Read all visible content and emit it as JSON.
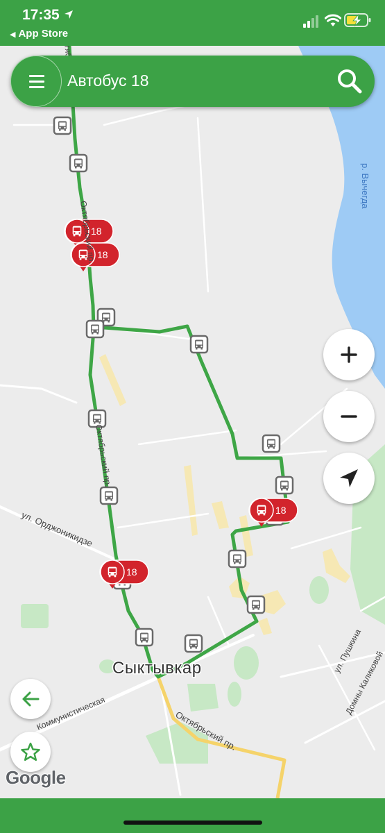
{
  "status_bar": {
    "time": "17:35",
    "back_app": "App Store"
  },
  "search": {
    "title": "Автобус 18"
  },
  "map": {
    "route_color": "#3ea646",
    "vehicle_color": "#d2242c",
    "city_label": "Сыктывкар",
    "street_labels": {
      "oktyabrsky_north": "Октябрьский пр.",
      "oktyabrsky_north_top": "Октябрьский пр.",
      "oktyabrsky_south": "Октябрьский пр.",
      "ordzhonikidze": "ул. Орджоникидзе",
      "kommunisticheskaya": "Коммунистическая",
      "pushkina": "ул. Пушкина",
      "domny_kalikovoy": "Домны Каликовой",
      "river": "р. Вычегда"
    },
    "vehicles": [
      {
        "route": "18"
      },
      {
        "route": "18"
      },
      {
        "route": "18"
      },
      {
        "route": "18"
      }
    ]
  },
  "controls": {
    "zoom_in": "+",
    "zoom_out": "−"
  },
  "attribution": "Google"
}
